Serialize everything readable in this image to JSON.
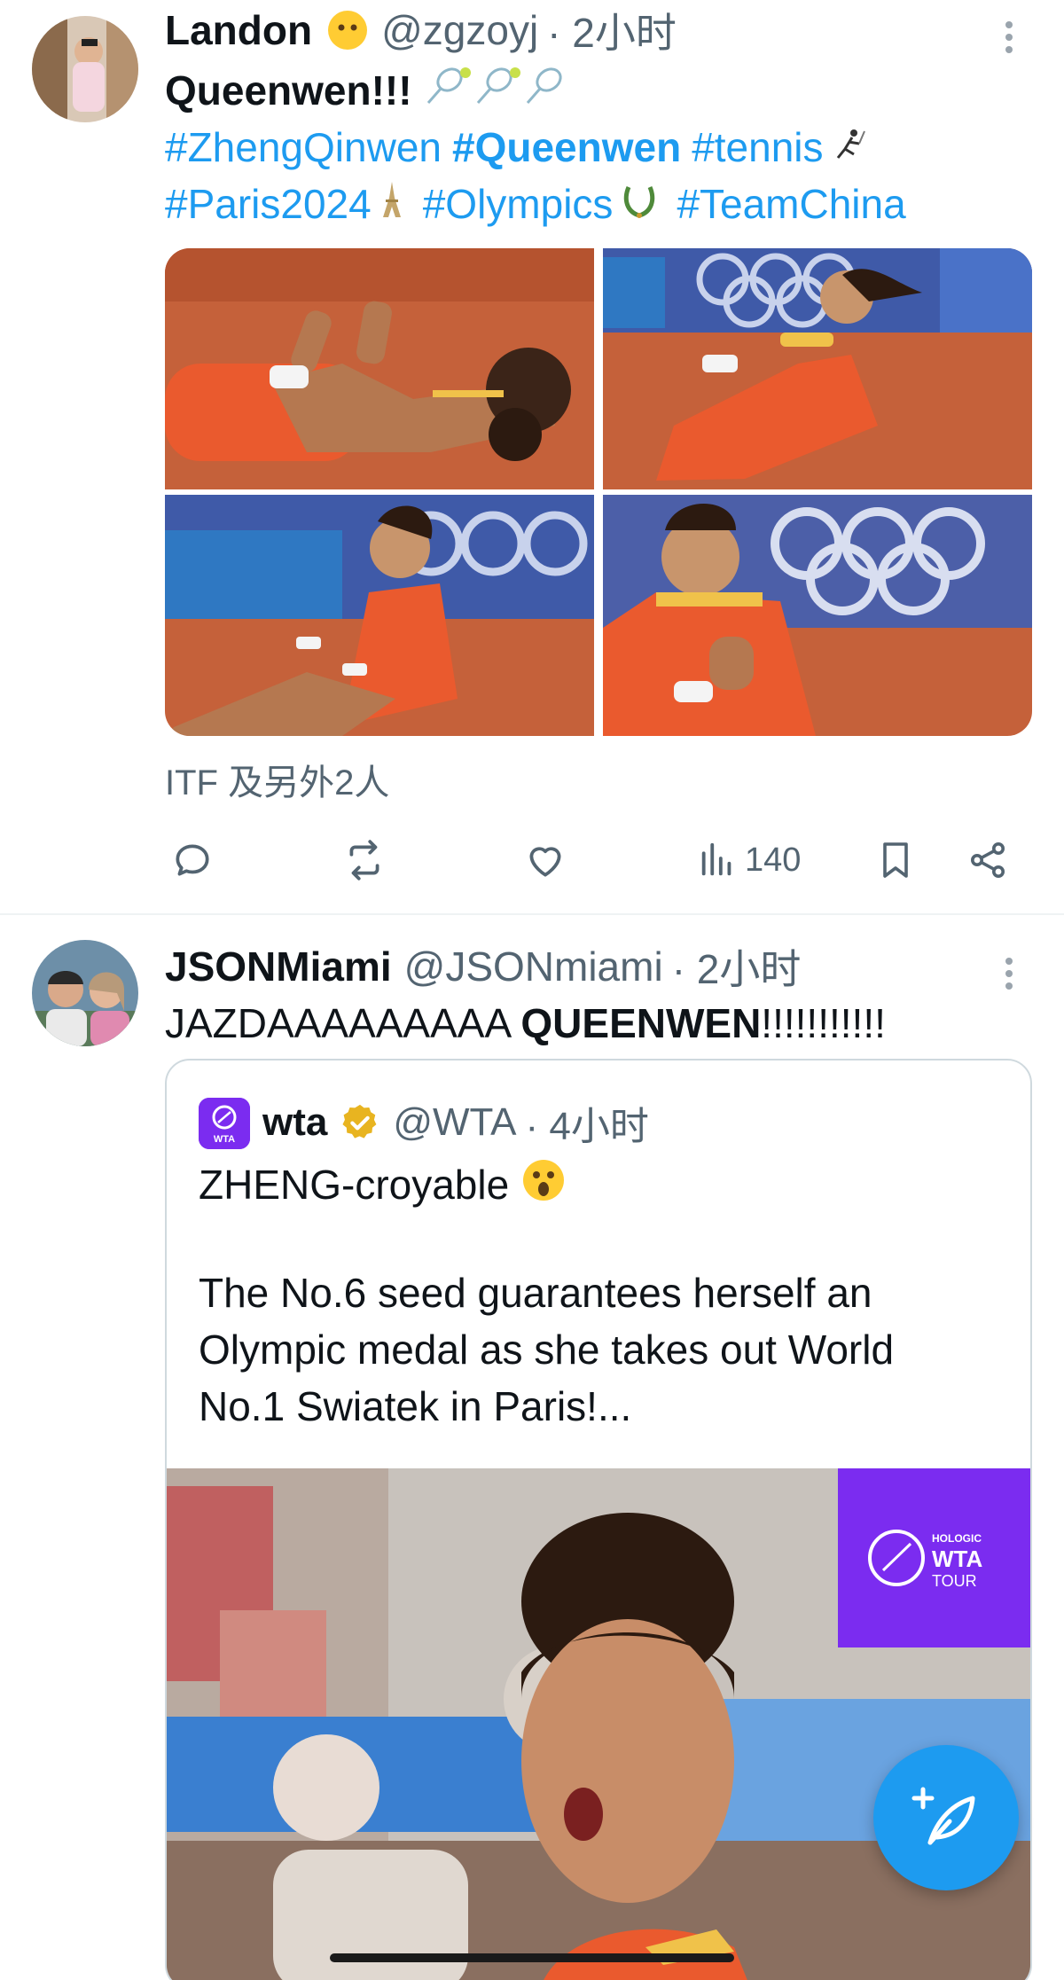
{
  "tweets": [
    {
      "author_name": "Landon",
      "handle": "@zgzoyj",
      "time": "· 2小时",
      "title": "Queenwen!!!",
      "hashtags_line1": [
        "#ZhengQinwen",
        "#Queenwen",
        "#tennis"
      ],
      "hashtags_line2": [
        "#Paris2024",
        "#Olympics",
        "#TeamChina"
      ],
      "liked_by": "ITF 及另外2人",
      "views": "140",
      "icons": {
        "author_emoji": "neutral-face-icon",
        "title_emoji": "tennis-racket-icon",
        "tennis": "tennis-player-icon",
        "paris": "eiffel-tower-icon",
        "olympics": "laurel-wreath-icon"
      }
    },
    {
      "author_name": "JSONMiami",
      "handle": "@JSONmiami",
      "time": "· 2小时",
      "text_plain": "JAZDAAAAAAAAA ",
      "text_bold": "QUEENWEN",
      "text_tail": "!!!!!!!!!!!"
    }
  ],
  "quote": {
    "author_name": "wta",
    "handle": "@WTA",
    "time": "· 4小时",
    "line1": "ZHENG-croyable",
    "line2": "The No.6 seed guarantees herself an",
    "line3": "Olympic medal as she takes out World",
    "line4": "No.1 Swiatek in Paris!...",
    "logo_small": "WTA",
    "logo_brand_top": "HOLOGIC",
    "logo_brand_mid": "WTA",
    "logo_brand_bottom": "TOUR"
  },
  "colors": {
    "accent": "#1d9bf0",
    "text": "#0f1419",
    "muted": "#536471",
    "wta_purple": "#7b2cf0",
    "clay": "#c5613a"
  }
}
